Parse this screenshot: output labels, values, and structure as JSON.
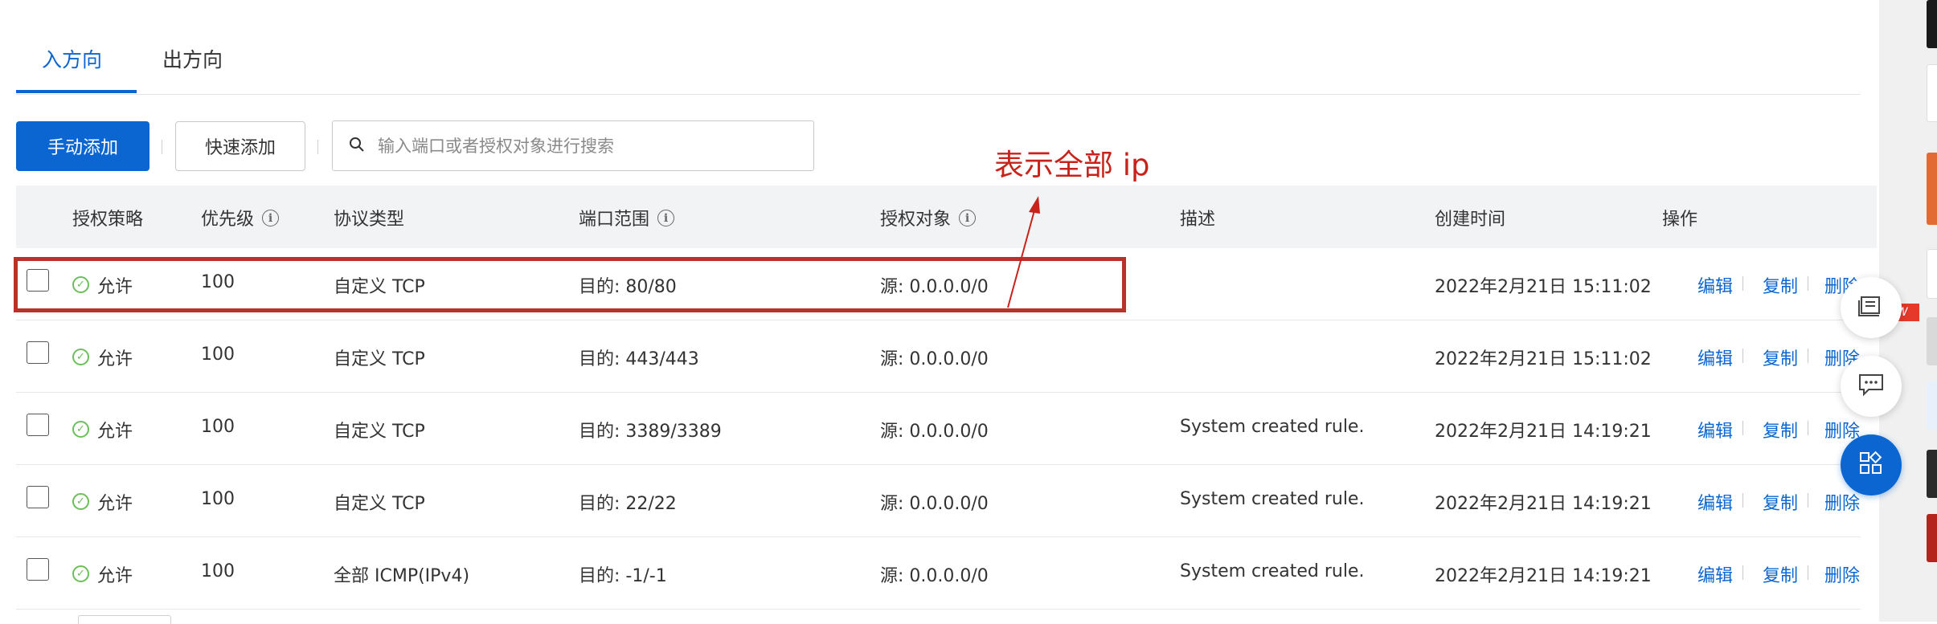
{
  "tabs": [
    {
      "label": "入方向",
      "active": true
    },
    {
      "label": "出方向",
      "active": false
    }
  ],
  "toolbar": {
    "manual_add": "手动添加",
    "quick_add": "快速添加",
    "search_placeholder": "输入端口或者授权对象进行搜索"
  },
  "annotation": {
    "text": "表示全部 ip",
    "color": "#c8231b"
  },
  "table": {
    "headers": {
      "policy": "授权策略",
      "priority": "优先级",
      "protocol": "协议类型",
      "port_range": "端口范围",
      "auth_object": "授权对象",
      "description": "描述",
      "created": "创建时间",
      "actions": "操作"
    },
    "action_labels": {
      "edit": "编辑",
      "copy": "复制",
      "delete": "删除"
    },
    "rows": [
      {
        "policy": "允许",
        "priority": "100",
        "protocol": "自定义 TCP",
        "port": "目的: 80/80",
        "source": "源: 0.0.0.0/0",
        "description": "",
        "created": "2022年2月21日 15:11:02"
      },
      {
        "policy": "允许",
        "priority": "100",
        "protocol": "自定义 TCP",
        "port": "目的: 443/443",
        "source": "源: 0.0.0.0/0",
        "description": "",
        "created": "2022年2月21日 15:11:02"
      },
      {
        "policy": "允许",
        "priority": "100",
        "protocol": "自定义 TCP",
        "port": "目的: 3389/3389",
        "source": "源: 0.0.0.0/0",
        "description": "System created rule.",
        "created": "2022年2月21日 14:19:21"
      },
      {
        "policy": "允许",
        "priority": "100",
        "protocol": "自定义 TCP",
        "port": "目的: 22/22",
        "source": "源: 0.0.0.0/0",
        "description": "System created rule.",
        "created": "2022年2月21日 14:19:21"
      },
      {
        "policy": "允许",
        "priority": "100",
        "protocol": "全部 ICMP(IPv4)",
        "port": "目的: -1/-1",
        "source": "源: 0.0.0.0/0",
        "description": "System created rule.",
        "created": "2022年2月21日 14:19:21"
      }
    ]
  },
  "floating": {
    "new_badge": "NEW"
  },
  "colors": {
    "primary": "#0b66d1",
    "success": "#6bbf59",
    "annotation": "#c8231b"
  }
}
